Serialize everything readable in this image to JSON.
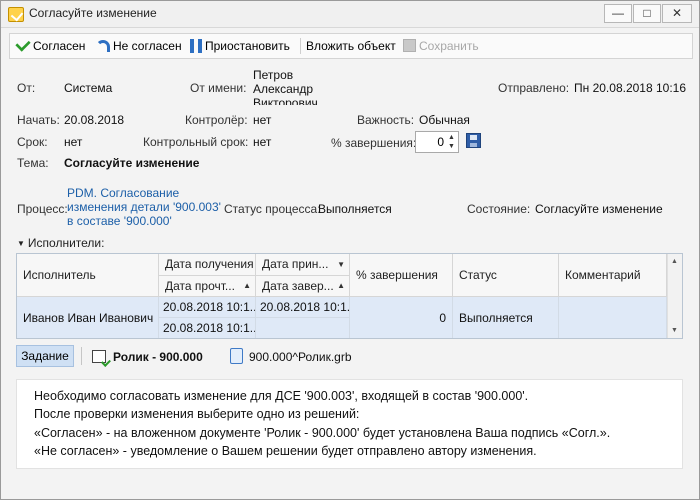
{
  "window": {
    "title": "Согласуйте изменение",
    "buttons": {
      "minimize": "—",
      "maximize": "□",
      "close": "✕"
    }
  },
  "toolbar": {
    "agree_label": "Согласен",
    "disagree_label": "Не согласен",
    "pause_label": "Приостановить",
    "attach_label": "Вложить объект",
    "save_label": "Сохранить"
  },
  "form": {
    "from_label": "От:",
    "from_value": "Система",
    "on_behalf_label": "От имени:",
    "on_behalf_value": "Петров Александр Викторович",
    "sent_label": "Отправлено:",
    "sent_value": "Пн 20.08.2018 10:16",
    "start_label": "Начать:",
    "start_value": "20.08.2018",
    "controller_label": "Контролёр:",
    "controller_value": "нет",
    "importance_label": "Важность:",
    "importance_value": "Обычная",
    "deadline_label": "Срок:",
    "deadline_value": "нет",
    "control_deadline_label": "Контрольный срок:",
    "control_deadline_value": "нет",
    "completion_label": "% завершения:",
    "completion_value": "0",
    "subject_label": "Тема:",
    "subject_value": "Согласуйте изменение",
    "process_label": "Процесс:",
    "process_link": "PDM. Согласование изменения детали '900.003' в составе '900.000'",
    "process_status_label": "Статус процесса:",
    "process_status_value": "Выполняется",
    "state_label": "Состояние:",
    "state_value": "Согласуйте изменение"
  },
  "executors": {
    "group_label": "Исполнители:",
    "headers": {
      "executor": "Исполнитель",
      "received": "Дата получения",
      "read": "Дата прочт...",
      "accepted": "Дата прин...",
      "completed": "Дата завер...",
      "percent": "% завершения",
      "status": "Статус",
      "comment": "Комментарий"
    },
    "rows": [
      {
        "executor": "Иванов Иван Иванович",
        "received": "20.08.2018 10:1...",
        "read": "20.08.2018 10:1...",
        "accepted": "20.08.2018 10:1...",
        "completed": "",
        "percent": "0",
        "status": "Выполняется",
        "comment": ""
      }
    ]
  },
  "tabs": {
    "task_label": "Задание",
    "doc_label": "Ролик - 900.000",
    "file_label": "900.000^Ролик.grb"
  },
  "message": {
    "lines": [
      "Необходимо согласовать изменение для ДСЕ '900.003', входящей в состав '900.000'.",
      "После проверки изменения выберите одно из решений:",
      "«Согласен» - на вложенном документе 'Ролик - 900.000' будет установлена Ваша подпись «Согл.».",
      "«Не согласен» - уведомление о Вашем решении будет отправлено автору изменения."
    ]
  }
}
